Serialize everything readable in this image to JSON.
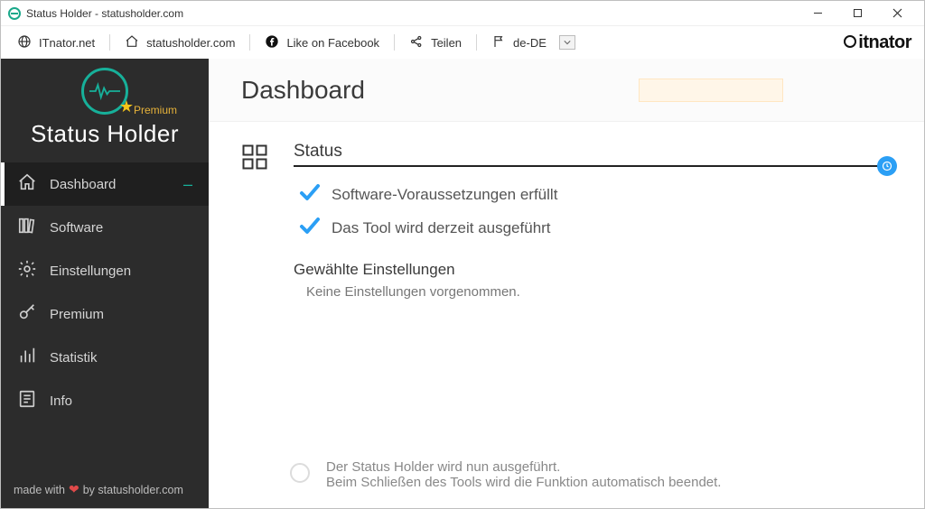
{
  "window": {
    "title": "Status Holder - statusholder.com"
  },
  "toolbar": {
    "links": [
      {
        "id": "itnator",
        "label": "ITnator.net",
        "icon": "globe-icon"
      },
      {
        "id": "site",
        "label": "statusholder.com",
        "icon": "home-icon"
      },
      {
        "id": "facebook",
        "label": "Like on Facebook",
        "icon": "facebook-icon"
      },
      {
        "id": "share",
        "label": "Teilen",
        "icon": "share-icon"
      },
      {
        "id": "lang",
        "label": "de-DE",
        "icon": "flag-icon"
      }
    ],
    "brand": "itnator"
  },
  "sidebar": {
    "app_name": "Status Holder",
    "premium_tag": "Premium",
    "items": [
      {
        "id": "dashboard",
        "label": "Dashboard",
        "icon": "home-icon",
        "active": true
      },
      {
        "id": "software",
        "label": "Software",
        "icon": "books-icon",
        "active": false
      },
      {
        "id": "einstellungen",
        "label": "Einstellungen",
        "icon": "gear-icon",
        "active": false
      },
      {
        "id": "premium",
        "label": "Premium",
        "icon": "key-icon",
        "active": false
      },
      {
        "id": "statistik",
        "label": "Statistik",
        "icon": "stats-icon",
        "active": false
      },
      {
        "id": "info",
        "label": "Info",
        "icon": "info-icon",
        "active": false
      }
    ],
    "footer_prefix": "made with",
    "footer_suffix": "by statusholder.com"
  },
  "page": {
    "title": "Dashboard",
    "status": {
      "heading": "Status",
      "checks": [
        "Software-Voraussetzungen erfüllt",
        "Das Tool wird derzeit ausgeführt"
      ]
    },
    "settings": {
      "heading": "Gewählte Einstellungen",
      "empty_text": "Keine Einstellungen vorgenommen."
    },
    "footer_note": {
      "line1": "Der Status Holder wird nun ausgeführt.",
      "line2": "Beim Schließen des Tools wird die Funktion automatisch beendet."
    }
  },
  "colors": {
    "accent": "#0e9bd8",
    "teal": "#17b09a",
    "check": "#2b9ff5"
  }
}
